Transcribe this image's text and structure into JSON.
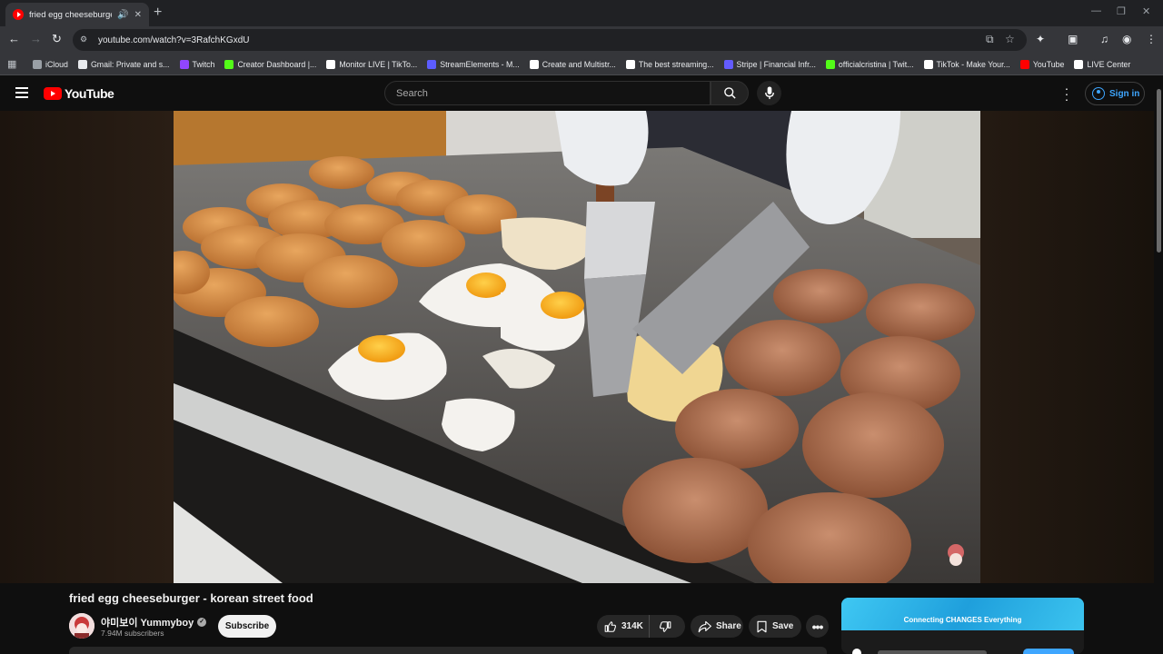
{
  "browser": {
    "tab_title": "fried egg cheeseburger - k",
    "url": "youtube.com/watch?v=3RafchKGxdU",
    "bookmarks": [
      {
        "label": "iCloud",
        "color": "#9aa0a6"
      },
      {
        "label": "Gmail: Private and s...",
        "color": "#e8eaed"
      },
      {
        "label": "Twitch",
        "color": "#9146ff"
      },
      {
        "label": "Creator Dashboard |...",
        "color": "#53fc18"
      },
      {
        "label": "Monitor LIVE | TikTo...",
        "color": "#ffffff"
      },
      {
        "label": "StreamElements - M...",
        "color": "#5c5cff"
      },
      {
        "label": "Create and Multistr...",
        "color": "#ffffff"
      },
      {
        "label": "The best streaming...",
        "color": "#ffffff"
      },
      {
        "label": "Stripe | Financial Infr...",
        "color": "#635bff"
      },
      {
        "label": "officialcristina | Twit...",
        "color": "#53fc18"
      },
      {
        "label": "TikTok - Make Your...",
        "color": "#ffffff"
      },
      {
        "label": "YouTube",
        "color": "#ff0000"
      },
      {
        "label": "LIVE Center",
        "color": "#ffffff"
      }
    ]
  },
  "youtube": {
    "logo_text": "YouTube",
    "search_placeholder": "Search",
    "sign_in_label": "Sign in"
  },
  "video": {
    "title": "fried egg cheeseburger - korean street food",
    "channel_name": "야미보이 Yummyboy",
    "subscribers": "7.94M subscribers",
    "subscribe_label": "Subscribe",
    "likes": "314K",
    "share_label": "Share",
    "save_label": "Save"
  },
  "ad": {
    "banner_text": "Connecting CHANGES Everything"
  },
  "colors": {
    "youtube_red": "#ff0000",
    "link_blue": "#3ea6ff",
    "page_bg": "#0f0f0f"
  }
}
